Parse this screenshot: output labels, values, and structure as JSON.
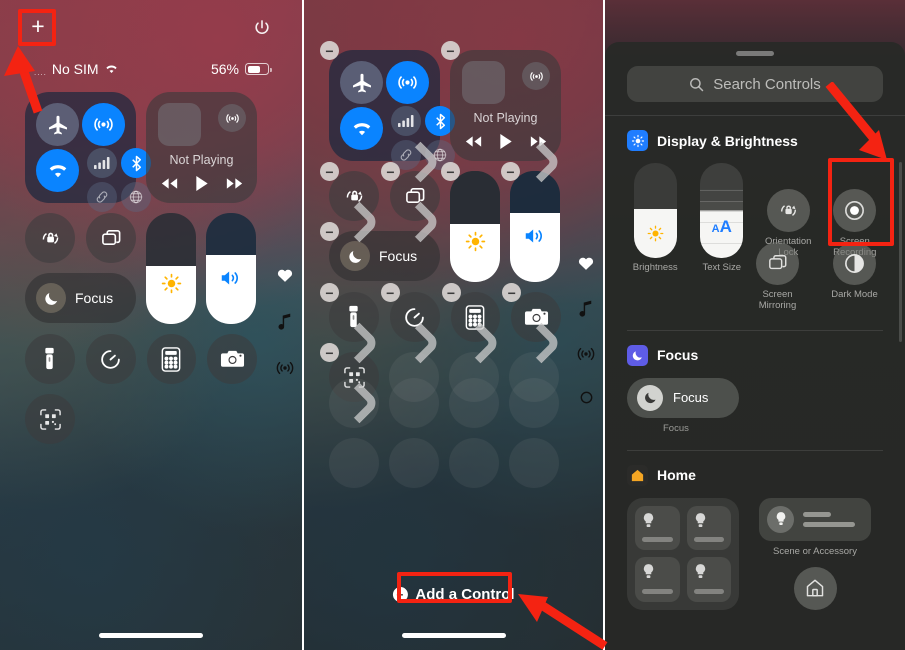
{
  "panel1": {
    "name": "Control Center",
    "topbar": {
      "add_label": "+",
      "add_icon": "plus-icon",
      "power_icon": "power-icon"
    },
    "statusbar": {
      "signal_dots": "....",
      "carrier": "No SIM",
      "wifi_icon": "wifi-icon",
      "battery_percent": "56%",
      "battery_icon": "battery-icon"
    },
    "connectivity": {
      "airplane": "airplane-mode",
      "airdrop": "airdrop",
      "wifi": "wifi",
      "cellular": "cellular-data",
      "bluetooth": "bluetooth",
      "hotspot": "personal-hotspot",
      "vpn": "vpn"
    },
    "media": {
      "title": "Not Playing",
      "airplay_icon": "airplay-icon",
      "rewind": "◀◀",
      "play": "▶",
      "forward": "▶▶"
    },
    "controls": {
      "orientation_lock": "orientation-lock",
      "screen_mirroring": "screen-mirroring",
      "focus_label": "Focus",
      "brightness": "brightness-slider",
      "volume": "volume-slider",
      "flashlight": "flashlight",
      "timer": "timer",
      "calculator": "calculator",
      "camera": "camera",
      "code_scanner": "code-scanner"
    },
    "page_icons": [
      "heart-icon",
      "music-note-icon",
      "connectivity-icon"
    ],
    "home_indicator": "home-indicator"
  },
  "panel2": {
    "name": "Control Center Edit Mode",
    "remove_badge": "−",
    "add_control_label": "Add a Control",
    "add_control_icon": "plus-circle-icon",
    "media": {
      "title": "Not Playing"
    },
    "focus_label": "Focus",
    "page_icons": [
      "heart-icon",
      "music-note-icon",
      "connectivity-icon",
      "circle-icon"
    ],
    "home_indicator": "home-indicator"
  },
  "panel3": {
    "name": "Controls Gallery",
    "search": {
      "placeholder": "Search Controls",
      "icon": "search-icon"
    },
    "sections": [
      {
        "title": "Display & Brightness",
        "icon": "display-brightness-icon",
        "icon_color": "#1f7dff",
        "items": [
          {
            "label": "Brightness",
            "type": "slider",
            "icon": "sun-icon"
          },
          {
            "label": "Text Size",
            "type": "slider",
            "icon": "text-size-icon"
          },
          {
            "label": "Orientation\nLock",
            "type": "circle",
            "icon": "orientation-lock-icon"
          },
          {
            "label": "Screen\nRecording",
            "type": "circle",
            "icon": "record-icon",
            "highlighted": true
          }
        ],
        "items_row2": [
          {
            "label": "Screen\nMirroring",
            "type": "circle",
            "icon": "screen-mirroring-icon"
          },
          {
            "label": "Dark Mode",
            "type": "circle",
            "icon": "dark-mode-icon"
          }
        ]
      },
      {
        "title": "Focus",
        "icon": "focus-icon",
        "icon_color": "#5e5ce6",
        "pill_label": "Focus",
        "caption": "Focus"
      },
      {
        "title": "Home",
        "icon": "home-icon",
        "icon_color": "#f5a623",
        "scene_label": "Scene or Accessory"
      }
    ]
  },
  "annotations": {
    "color": "#f42312",
    "boxes": [
      {
        "target": "add-control-plus-button"
      },
      {
        "target": "add-a-control-button"
      },
      {
        "target": "screen-recording-control"
      }
    ],
    "arrows": [
      {
        "target": "add-control-plus-button"
      },
      {
        "target": "add-a-control-button"
      },
      {
        "target": "screen-recording-control"
      }
    ]
  }
}
